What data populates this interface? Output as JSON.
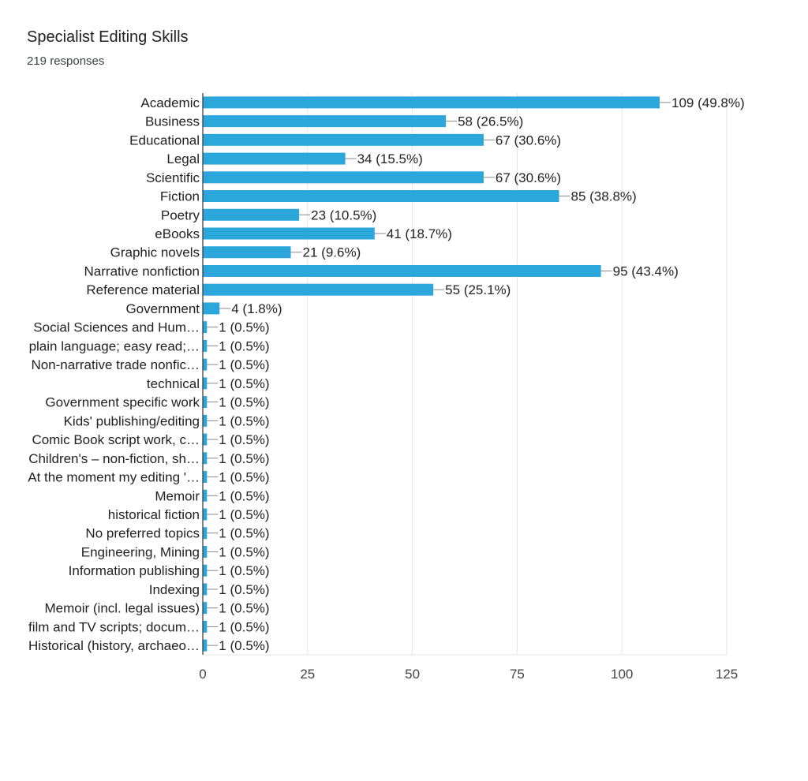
{
  "header": {
    "title": "Specialist Editing Skills",
    "responses": "219 responses"
  },
  "chart_data": {
    "type": "bar",
    "orientation": "horizontal",
    "title": "Specialist Editing Skills",
    "subtitle": "219 responses",
    "xlabel": "",
    "ylabel": "",
    "xlim": [
      0,
      125
    ],
    "xticks": [
      0,
      25,
      50,
      75,
      100,
      125
    ],
    "grid": true,
    "bar_color": "#2ba7db",
    "categories": [
      "Academic",
      "Business",
      "Educational",
      "Legal",
      "Scientific",
      "Fiction",
      "Poetry",
      "eBooks",
      "Graphic novels",
      "Narrative nonfiction",
      "Reference material",
      "Government",
      "Social Sciences and Hum…",
      "plain language; easy read;…",
      "Non-narrative trade nonfic…",
      "technical",
      "Government specific work",
      "Kids' publishing/editing",
      "Comic Book script work, c…",
      "Children's – non-fiction, sh…",
      "At the moment my editing '…",
      "Memoir",
      "historical fiction",
      "No preferred topics",
      "Engineering, Mining",
      "Information publishing",
      "Indexing",
      "Memoir (incl. legal issues)",
      "film and TV scripts; docum…",
      "Historical (history, archaeo…"
    ],
    "values": [
      109,
      58,
      67,
      34,
      67,
      85,
      23,
      41,
      21,
      95,
      55,
      4,
      1,
      1,
      1,
      1,
      1,
      1,
      1,
      1,
      1,
      1,
      1,
      1,
      1,
      1,
      1,
      1,
      1,
      1
    ],
    "labels": [
      "109 (49.8%)",
      "58 (26.5%)",
      "67 (30.6%)",
      "34 (15.5%)",
      "67 (30.6%)",
      "85 (38.8%)",
      "23 (10.5%)",
      "41 (18.7%)",
      "21 (9.6%)",
      "95 (43.4%)",
      "55 (25.1%)",
      "4 (1.8%)",
      "1 (0.5%)",
      "1 (0.5%)",
      "1 (0.5%)",
      "1 (0.5%)",
      "1 (0.5%)",
      "1 (0.5%)",
      "1 (0.5%)",
      "1 (0.5%)",
      "1 (0.5%)",
      "1 (0.5%)",
      "1 (0.5%)",
      "1 (0.5%)",
      "1 (0.5%)",
      "1 (0.5%)",
      "1 (0.5%)",
      "1 (0.5%)",
      "1 (0.5%)",
      "1 (0.5%)"
    ]
  }
}
